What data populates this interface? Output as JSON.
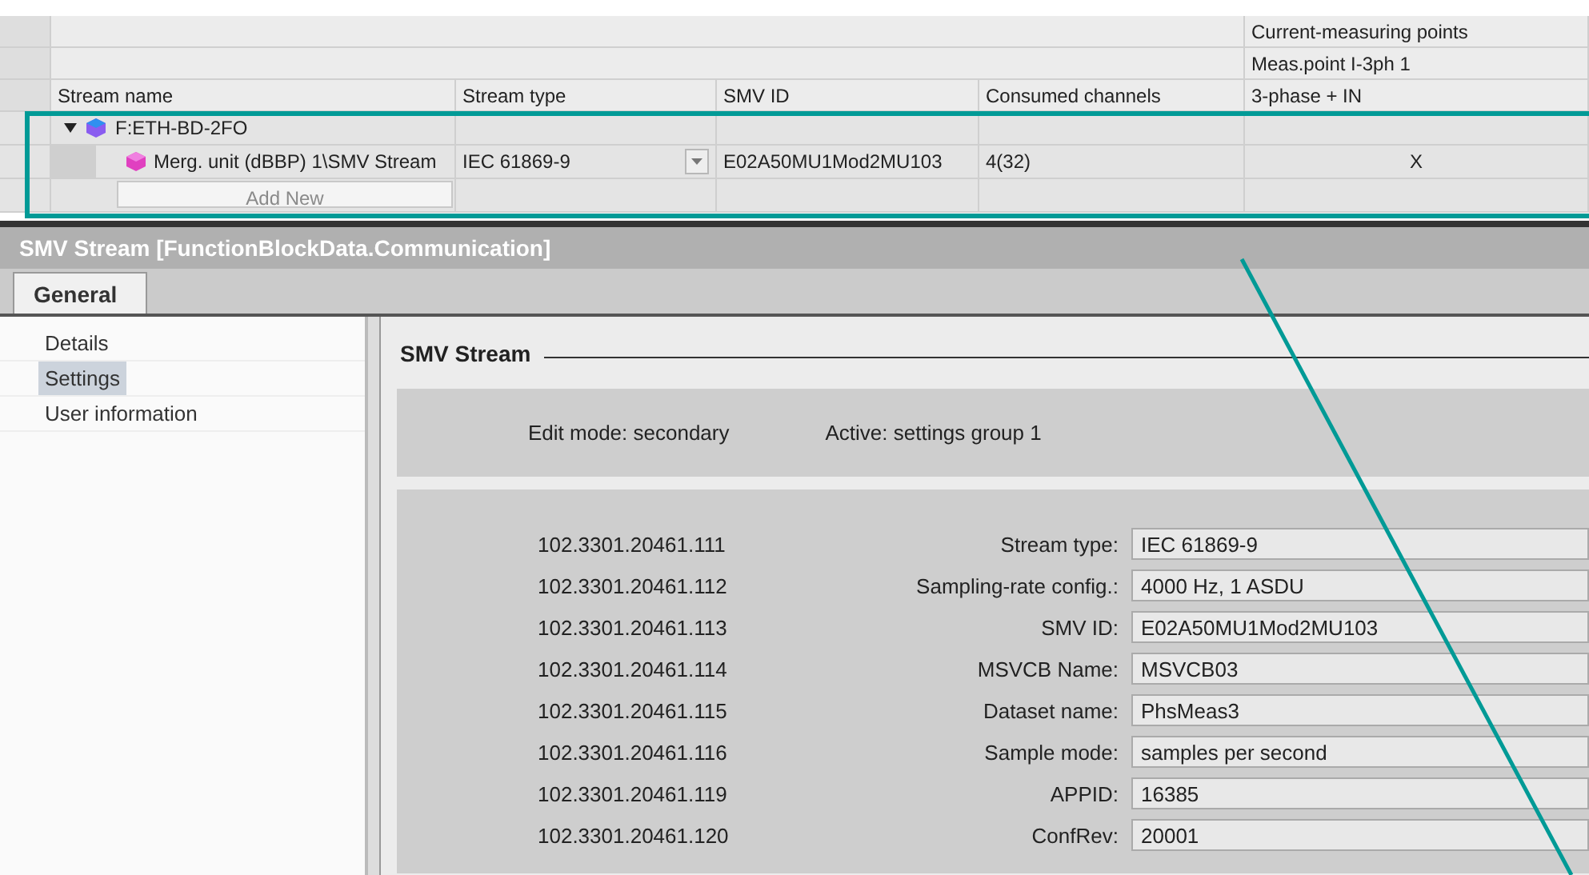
{
  "stream_table": {
    "group_headers": [
      {
        "label": "Current-measuring points"
      },
      {
        "label": "Meas.point I-3ph 1"
      }
    ],
    "columns": [
      "Stream name",
      "Stream type",
      "SMV ID",
      "Consumed channels",
      "3-phase + IN"
    ],
    "rows": [
      {
        "name": "F:ETH-BD-2FO",
        "expanded": true,
        "children": [
          {
            "name": "Merg. unit (dBBP) 1\\SMV Stream",
            "stream_type": "IEC 61869-9",
            "smv_id": "E02A50MU1Mod2MU103",
            "consumed_channels": "4(32)",
            "three_phase_in": "X"
          }
        ]
      }
    ],
    "add_new": "Add New"
  },
  "inspector": {
    "title": "SMV Stream [FunctionBlockData.Communication]",
    "tabs": [
      {
        "label": "General",
        "selected": true
      }
    ],
    "nav": [
      {
        "label": "Details",
        "selected": false
      },
      {
        "label": "Settings",
        "selected": true
      },
      {
        "label": "User information",
        "selected": false
      }
    ],
    "section_title": "SMV Stream",
    "edit_mode": "Edit mode: secondary",
    "active_group": "Active: settings group 1",
    "params": [
      {
        "id": "102.3301.20461.111",
        "label": "Stream type:",
        "value": "IEC 61869-9"
      },
      {
        "id": "102.3301.20461.112",
        "label": "Sampling-rate config.:",
        "value": "4000 Hz, 1 ASDU"
      },
      {
        "id": "102.3301.20461.113",
        "label": "SMV ID:",
        "value": "E02A50MU1Mod2MU103"
      },
      {
        "id": "102.3301.20461.114",
        "label": "MSVCB Name:",
        "value": "MSVCB03"
      },
      {
        "id": "102.3301.20461.115",
        "label": "Dataset name:",
        "value": "PhsMeas3"
      },
      {
        "id": "102.3301.20461.116",
        "label": "Sample mode:",
        "value": "samples per second"
      },
      {
        "id": "102.3301.20461.119",
        "label": "APPID:",
        "value": "16385"
      },
      {
        "id": "102.3301.20461.120",
        "label": "ConfRev:",
        "value": "20001"
      }
    ]
  }
}
